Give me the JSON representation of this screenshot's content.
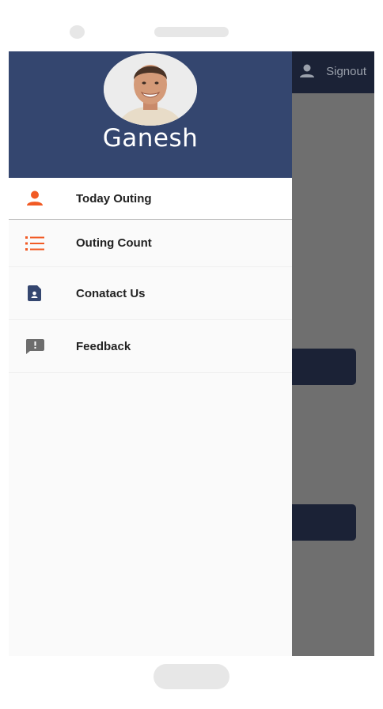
{
  "app_bar": {
    "signout_label": "Signout"
  },
  "drawer": {
    "user_name": "Ganesh",
    "items": [
      {
        "label": "Today Outing",
        "icon": "person-icon"
      },
      {
        "label": "Outing Count",
        "icon": "numbered-list-icon"
      },
      {
        "label": "Conatact Us",
        "icon": "contact-file-icon"
      },
      {
        "label": "Feedback",
        "icon": "feedback-icon"
      }
    ]
  },
  "colors": {
    "drawer_header": "#34466f",
    "accent_orange": "#f15a24",
    "app_bar": "#1b2236",
    "scrim": "#6f6f6f"
  }
}
